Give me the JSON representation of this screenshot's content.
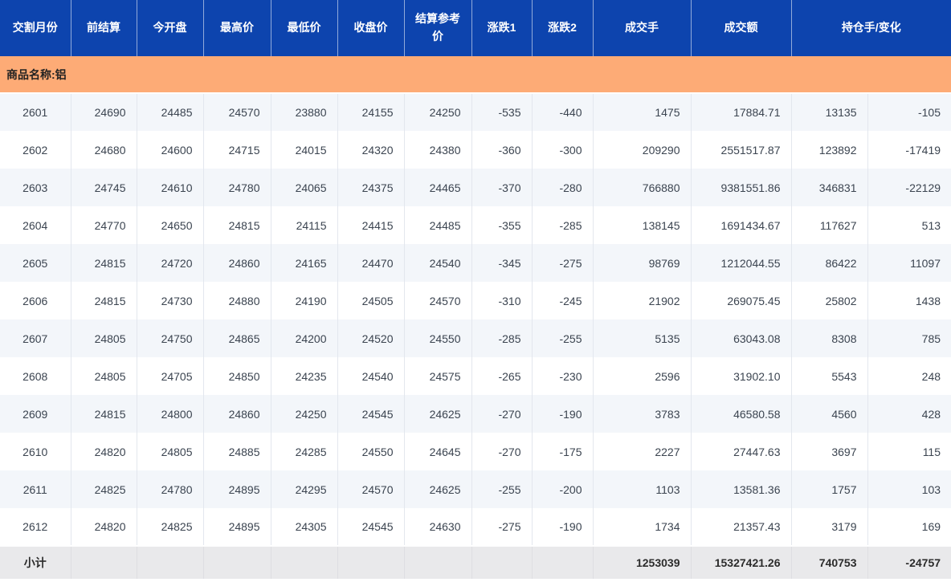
{
  "table": {
    "headers": [
      "交割月份",
      "前结算",
      "今开盘",
      "最高价",
      "最低价",
      "收盘价",
      "结算参考价",
      "涨跌1",
      "涨跌2",
      "成交手",
      "成交额",
      "持仓手/变化"
    ],
    "group_label": "商品名称:铝",
    "rows": [
      [
        "2601",
        "24690",
        "24485",
        "24570",
        "23880",
        "24155",
        "24250",
        "-535",
        "-440",
        "1475",
        "17884.71",
        "13135",
        "-105"
      ],
      [
        "2602",
        "24680",
        "24600",
        "24715",
        "24015",
        "24320",
        "24380",
        "-360",
        "-300",
        "209290",
        "2551517.87",
        "123892",
        "-17419"
      ],
      [
        "2603",
        "24745",
        "24610",
        "24780",
        "24065",
        "24375",
        "24465",
        "-370",
        "-280",
        "766880",
        "9381551.86",
        "346831",
        "-22129"
      ],
      [
        "2604",
        "24770",
        "24650",
        "24815",
        "24115",
        "24415",
        "24485",
        "-355",
        "-285",
        "138145",
        "1691434.67",
        "117627",
        "513"
      ],
      [
        "2605",
        "24815",
        "24720",
        "24860",
        "24165",
        "24470",
        "24540",
        "-345",
        "-275",
        "98769",
        "1212044.55",
        "86422",
        "11097"
      ],
      [
        "2606",
        "24815",
        "24730",
        "24880",
        "24190",
        "24505",
        "24570",
        "-310",
        "-245",
        "21902",
        "269075.45",
        "25802",
        "1438"
      ],
      [
        "2607",
        "24805",
        "24750",
        "24865",
        "24200",
        "24520",
        "24550",
        "-285",
        "-255",
        "5135",
        "63043.08",
        "8308",
        "785"
      ],
      [
        "2608",
        "24805",
        "24705",
        "24850",
        "24235",
        "24540",
        "24575",
        "-265",
        "-230",
        "2596",
        "31902.10",
        "5543",
        "248"
      ],
      [
        "2609",
        "24815",
        "24800",
        "24860",
        "24250",
        "24545",
        "24625",
        "-270",
        "-190",
        "3783",
        "46580.58",
        "4560",
        "428"
      ],
      [
        "2610",
        "24820",
        "24805",
        "24885",
        "24285",
        "24550",
        "24645",
        "-270",
        "-175",
        "2227",
        "27447.63",
        "3697",
        "115"
      ],
      [
        "2611",
        "24825",
        "24780",
        "24895",
        "24295",
        "24570",
        "24625",
        "-255",
        "-200",
        "1103",
        "13581.36",
        "1757",
        "103"
      ],
      [
        "2612",
        "24820",
        "24825",
        "24895",
        "24305",
        "24545",
        "24630",
        "-275",
        "-190",
        "1734",
        "21357.43",
        "3179",
        "169"
      ]
    ],
    "subtotal": {
      "label": "小计",
      "volume_total": "1253039",
      "turnover_total": "15327421.26",
      "open_interest_total": "740753",
      "oi_change_total": "-24757"
    }
  },
  "colors": {
    "header_bg": "#0d44ae",
    "group_row_bg": "#fdab76",
    "row_stripe_bg": "#f3f6fa",
    "row_plain_bg": "#ffffff",
    "subtotal_bg": "#e9e9eb",
    "header_text": "#ffffff",
    "body_text": "#3b4450"
  }
}
